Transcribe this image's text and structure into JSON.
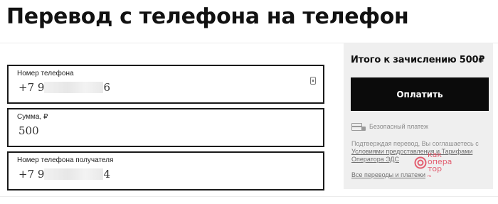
{
  "header": {
    "title": "Перевод с телефона на телефон"
  },
  "form": {
    "phone": {
      "label": "Номер телефона",
      "value_prefix": "+7 9",
      "value_suffix": "6"
    },
    "amount": {
      "label": "Сумма, ₽",
      "value": "500"
    },
    "recipient": {
      "label": "Номер телефона получателя",
      "value_prefix": "+7 9",
      "value_suffix": "4"
    }
  },
  "summary": {
    "total_text": "Итого к зачислению 500₽",
    "pay_label": "Оплатить",
    "secure_label": "Безопасный платеж",
    "agreement_text": "Подтверждая перевод, Вы соглашаетесь с",
    "terms_link": "Условиями предоставления и Тарифами Оператора ЭДС",
    "all_transfers_link": "Все переводы и платежи"
  },
  "watermark": {
    "line1": "как",
    "line2": "опера",
    "line3": "тор",
    "suffix": "ru"
  },
  "icons": {
    "contacts": "contacts-book-icon",
    "card": "card-icon",
    "lock": "lock-icon",
    "logo": "kakoperator-logo"
  },
  "colors": {
    "button": "#0b0b0b",
    "summary_bg": "#efefef",
    "watermark": "#e0455a"
  }
}
